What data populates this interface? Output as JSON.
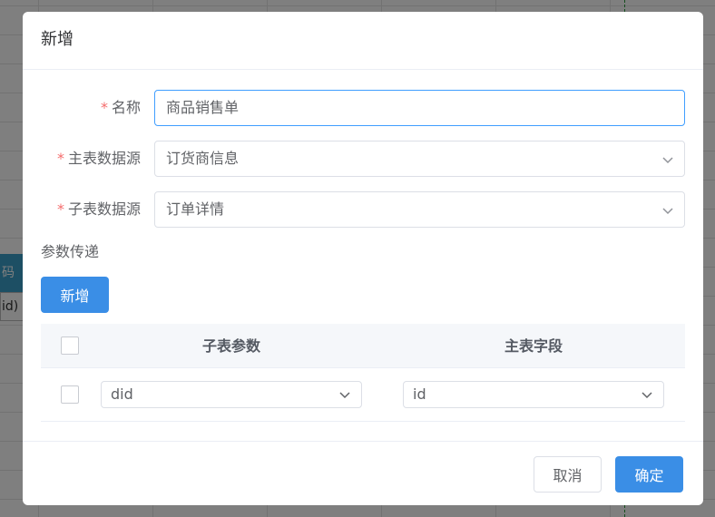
{
  "background": {
    "cell_header_text": "码",
    "cell_text": "id)"
  },
  "dialog": {
    "title": "新增",
    "fields": {
      "name": {
        "label": "名称",
        "value": "商品销售单"
      },
      "main_source": {
        "label": "主表数据源",
        "value": "订货商信息"
      },
      "sub_source": {
        "label": "子表数据源",
        "value": "订单详情"
      }
    },
    "params": {
      "section_label": "参数传递",
      "add_label": "新增",
      "columns": [
        "子表参数",
        "主表字段"
      ],
      "rows": [
        {
          "sub_param": "did",
          "main_field": "id"
        }
      ]
    },
    "footer": {
      "cancel_label": "取消",
      "confirm_label": "确定"
    }
  },
  "colors": {
    "primary": "#3a8ee6",
    "required": "#f56c6c",
    "focus_border": "#409eff"
  }
}
